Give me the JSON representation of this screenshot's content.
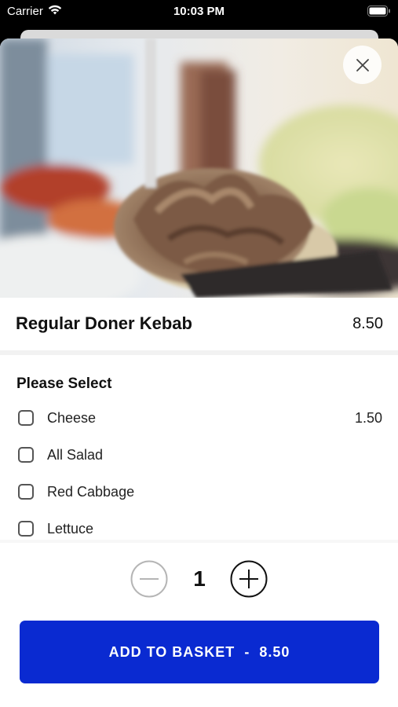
{
  "status_bar": {
    "carrier": "Carrier",
    "time": "10:03 PM"
  },
  "item": {
    "name": "Regular Doner Kebab",
    "price": "8.50"
  },
  "options": {
    "heading": "Please Select",
    "items": [
      {
        "label": "Cheese",
        "price": "1.50",
        "checked": false
      },
      {
        "label": "All Salad",
        "price": "",
        "checked": false
      },
      {
        "label": "Red Cabbage",
        "price": "",
        "checked": false
      },
      {
        "label": "Lettuce",
        "price": "",
        "checked": false
      }
    ]
  },
  "quantity": {
    "value": "1"
  },
  "add_button": {
    "label": "ADD TO BASKET",
    "separator": "-",
    "total": "8.50"
  },
  "colors": {
    "accent": "#0a2ad1",
    "sheet_background": "#ffffff",
    "status_bar_background": "#000000"
  },
  "icons": {
    "close": "close-icon",
    "minus": "minus-circle-icon",
    "plus": "plus-circle-icon",
    "wifi": "wifi-icon",
    "battery": "battery-icon"
  }
}
